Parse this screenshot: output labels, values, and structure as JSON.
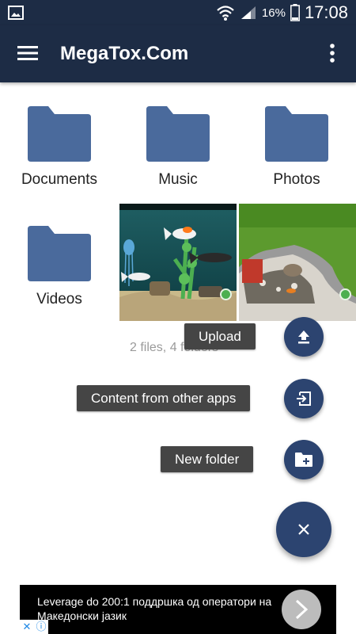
{
  "status_bar": {
    "battery_percent": "16%",
    "time": "17:08"
  },
  "app_bar": {
    "title": "MegaTox.Com"
  },
  "folders": [
    {
      "name": "Documents"
    },
    {
      "name": "Music"
    },
    {
      "name": "Photos"
    },
    {
      "name": "Videos"
    }
  ],
  "summary": {
    "count_text": "2 files, 4 folders"
  },
  "fab_menu": {
    "upload_label": "Upload",
    "content_label": "Content from other apps",
    "new_folder_label": "New folder"
  },
  "ad": {
    "text": "Leverage do 200:1 поддршка од оператори на Македонски јазик"
  },
  "colors": {
    "app_bar": "#1d2c45",
    "fab": "#2c4470",
    "folder": "#4a6a9c",
    "tooltip": "#454545"
  }
}
